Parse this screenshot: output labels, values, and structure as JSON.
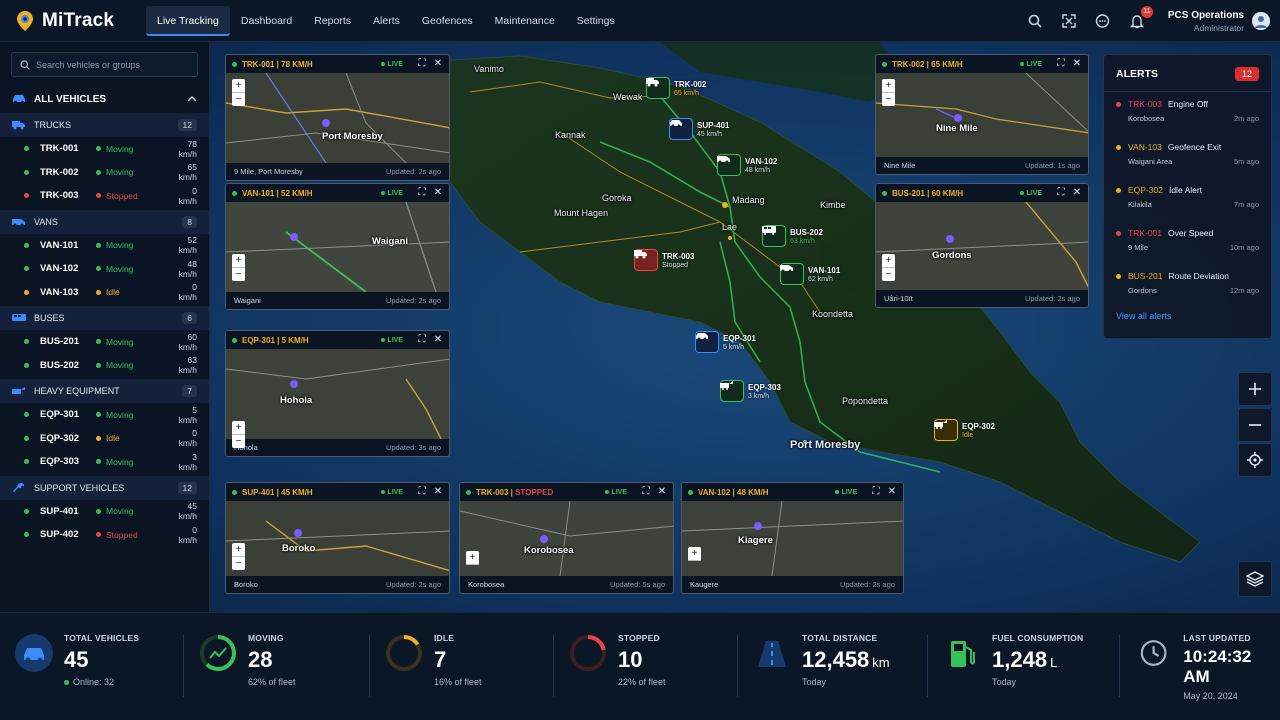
{
  "app": {
    "name": "MiTrack"
  },
  "nav": {
    "items": [
      "Live Tracking",
      "Dashboard",
      "Reports",
      "Alerts",
      "Geofences",
      "Maintenance",
      "Settings"
    ],
    "active": "Live Tracking"
  },
  "header": {
    "notification_count": "11",
    "user_name": "PCS Operations",
    "user_role": "Administrator"
  },
  "sidebar": {
    "search_placeholder": "Search vehicles or groups",
    "all_label": "ALL VEHICLES",
    "groups": [
      {
        "name": "TRUCKS",
        "count": "12",
        "icon": "truck-icon",
        "vehicles": [
          {
            "id": "TRK-001",
            "status": "Moving",
            "speed": "78 km/h",
            "color": "green"
          },
          {
            "id": "TRK-002",
            "status": "Moving",
            "speed": "65 km/h",
            "color": "green"
          },
          {
            "id": "TRK-003",
            "status": "Stopped",
            "speed": "0 km/h",
            "color": "red"
          }
        ]
      },
      {
        "name": "VANS",
        "count": "8",
        "icon": "van-icon",
        "vehicles": [
          {
            "id": "VAN-101",
            "status": "Moving",
            "speed": "52 km/h",
            "color": "green"
          },
          {
            "id": "VAN-102",
            "status": "Moving",
            "speed": "48 km/h",
            "color": "green"
          },
          {
            "id": "VAN-103",
            "status": "Idle",
            "speed": "0 km/h",
            "color": "yellow"
          }
        ]
      },
      {
        "name": "BUSES",
        "count": "6",
        "icon": "bus-icon",
        "vehicles": [
          {
            "id": "BUS-201",
            "status": "Moving",
            "speed": "60 km/h",
            "color": "green"
          },
          {
            "id": "BUS-202",
            "status": "Moving",
            "speed": "63 km/h",
            "color": "green"
          }
        ]
      },
      {
        "name": "HEAVY EQUIPMENT",
        "count": "7",
        "icon": "excavator-icon",
        "vehicles": [
          {
            "id": "EQP-301",
            "status": "Moving",
            "speed": "5 km/h",
            "color": "green"
          },
          {
            "id": "EQP-302",
            "status": "Idle",
            "speed": "0 km/h",
            "color": "yellow"
          },
          {
            "id": "EQP-303",
            "status": "Moving",
            "speed": "3 km/h",
            "color": "green"
          }
        ]
      },
      {
        "name": "SUPPORT VEHICLES",
        "count": "12",
        "icon": "wrench-icon",
        "vehicles": [
          {
            "id": "SUP-401",
            "status": "Moving",
            "speed": "45 km/h",
            "color": "green"
          },
          {
            "id": "SUP-402",
            "status": "Stopped",
            "speed": "0 km/h",
            "color": "red"
          }
        ]
      }
    ]
  },
  "cards": [
    {
      "id": "card-trk-001",
      "title": "TRK-001 | 78 KM/H",
      "title_color": "yellow",
      "place": "Port Moresby",
      "location": "9 Mile, Port Moresby",
      "updated": "Updated: 2s ago"
    },
    {
      "id": "card-van-101",
      "title": "VAN-101 | 52 KM/H",
      "title_color": "yellow",
      "place": "Waigani",
      "location": "Waigani",
      "updated": "Updated: 2s ago"
    },
    {
      "id": "card-eqp-301",
      "title": "EQP-301 | 5 KM/H",
      "title_color": "yellow",
      "place": "Hohola",
      "location": "Hohola",
      "updated": "Updated: 3s ago"
    },
    {
      "id": "card-sup-401",
      "title": "SUP-401 | 45 KM/H",
      "title_color": "yellow",
      "place": "Boroko",
      "location": "Boroko",
      "updated": "Updated: 2s ago"
    },
    {
      "id": "card-trk-003",
      "title_id": "TRK-003 | ",
      "title_status": "STOPPED",
      "place": "Korobosea",
      "location": "Korobosea",
      "updated": "Updated: 5s ago"
    },
    {
      "id": "card-van-102",
      "title": "VAN-102 | 48 KM/H",
      "title_color": "yellow",
      "place": "Kiagere",
      "location": "Kaugere",
      "updated": "Updated: 2s ago"
    },
    {
      "id": "card-trk-002",
      "title": "TRK-002 | 65 KM/H",
      "title_color": "yellow",
      "place": "Nine Mile",
      "location": "Nine Mile",
      "updated": "Updated: 1s ago"
    },
    {
      "id": "card-bus-201",
      "title": "BUS-201 | 60 KM/H",
      "title_color": "yellow",
      "place": "Gordons",
      "location": "Uâri-10ït",
      "updated": "Updated: 2s ago"
    }
  ],
  "card_live_label": "LIVE",
  "map": {
    "labels": [
      "Vanimo",
      "Wewak",
      "Kannak",
      "Goroka",
      "Mount Hagen",
      "Madang",
      "Kimbe",
      "Lae",
      "Koondetta",
      "Popondetta",
      "Port Moresby"
    ],
    "markers": [
      {
        "id": "TRK-002",
        "sub": "65 km/h",
        "sub_color": "#f0b020",
        "kind": "truck"
      },
      {
        "id": "SUP-401",
        "sub": "45 km/h",
        "sub_color": "#d5deea",
        "kind": "support"
      },
      {
        "id": "VAN-102",
        "sub": "48 km/h",
        "sub_color": "#d5deea",
        "kind": "van"
      },
      {
        "id": "BUS-202",
        "sub": "63 km/h",
        "sub_color": "#37c15a",
        "kind": "bus"
      },
      {
        "id": "TRK-003",
        "sub": "Stopped",
        "sub_color": "#d5deea",
        "kind": "truck-stopped"
      },
      {
        "id": "VAN-101",
        "sub": "62 km/h",
        "sub_color": "#d5deea",
        "kind": "van"
      },
      {
        "id": "EQP-301",
        "sub": "5 km/h",
        "sub_color": "#d5deea",
        "kind": "support"
      },
      {
        "id": "EQP-303",
        "sub": "3 km/h",
        "sub_color": "#d5deea",
        "kind": "excavator"
      },
      {
        "id": "EQP-302",
        "sub": "Idle",
        "sub_color": "#f0b020",
        "kind": "excavator-idle"
      }
    ]
  },
  "alerts": {
    "title": "ALERTS",
    "count": "12",
    "items": [
      {
        "vehicle": "TRK-003",
        "event": "Engine Off",
        "place": "Korobosea",
        "time": "2m ago",
        "color": "red"
      },
      {
        "vehicle": "VAN-103",
        "event": "Geofence Exit",
        "place": "Waigani Area",
        "time": "5m ago",
        "color": "yellow"
      },
      {
        "vehicle": "EQP-302",
        "event": "Idle Alert",
        "place": "Kilakila",
        "time": "7m ago",
        "color": "yellow"
      },
      {
        "vehicle": "TRK-001",
        "event": "Over Speed",
        "place": "9 Mile",
        "time": "10m ago",
        "color": "red"
      },
      {
        "vehicle": "BUS-201",
        "event": "Route Deviation",
        "place": "Gordons",
        "time": "12m ago",
        "color": "yellow"
      }
    ],
    "view_all": "View all alerts"
  },
  "stats": {
    "total_vehicles": {
      "label": "TOTAL VEHICLES",
      "value": "45",
      "sub": "Online: 32"
    },
    "moving": {
      "label": "MOVING",
      "value": "28",
      "sub": "62% of fleet",
      "fraction": 0.62
    },
    "idle": {
      "label": "IDLE",
      "value": "7",
      "sub": "16% of fleet",
      "fraction": 0.16
    },
    "stopped": {
      "label": "STOPPED",
      "value": "10",
      "sub": "22% of fleet",
      "fraction": 0.22
    },
    "distance": {
      "label": "TOTAL DISTANCE",
      "value": "12,458",
      "unit": "km",
      "sub": "Today"
    },
    "fuel": {
      "label": "FUEL CONSUMPTION",
      "value": "1,248",
      "unit": "L",
      "sub": "Today"
    },
    "updated": {
      "label": "LAST UPDATED",
      "value": "10:24:32 AM",
      "sub": "May 20, 2024"
    }
  },
  "colors": {
    "accent": "#3b8cff",
    "green": "#37c15a",
    "yellow": "#f0b020",
    "red": "#e84545"
  }
}
